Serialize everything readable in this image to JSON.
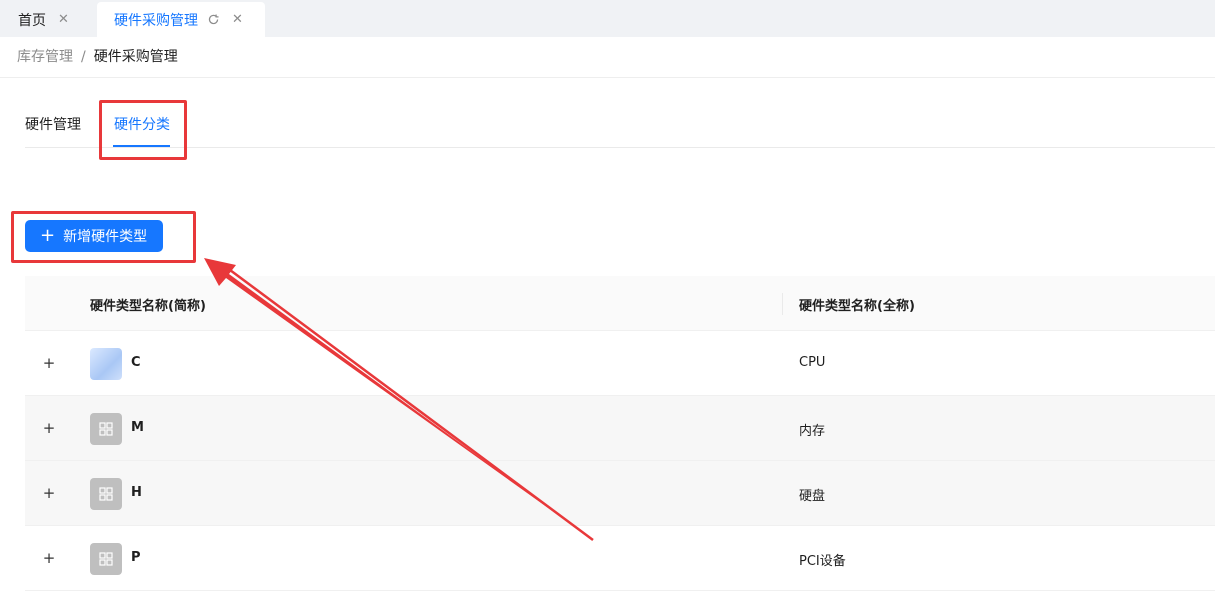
{
  "tabs_bar": {
    "home_label": "首页",
    "active_label": "硬件采购管理"
  },
  "breadcrumb": {
    "parent": "库存管理",
    "separator": "/",
    "current": "硬件采购管理"
  },
  "sub_tabs": [
    {
      "label": "硬件管理"
    },
    {
      "label": "硬件分类"
    }
  ],
  "toolbar": {
    "add_label": "新增硬件类型"
  },
  "table": {
    "columns": [
      "硬件类型名称(简称)",
      "硬件类型名称(全称)"
    ],
    "rows": [
      {
        "short": "C",
        "full": "CPU",
        "icon": "image-thumbnail-icon"
      },
      {
        "short": "M",
        "full": "内存",
        "icon": "grid-icon"
      },
      {
        "short": "H",
        "full": "硬盘",
        "icon": "grid-icon"
      },
      {
        "short": "P",
        "full": "PCI设备",
        "icon": "grid-icon"
      }
    ]
  },
  "colors": {
    "accent": "#1677ff",
    "annotation_red": "#e8383a"
  }
}
